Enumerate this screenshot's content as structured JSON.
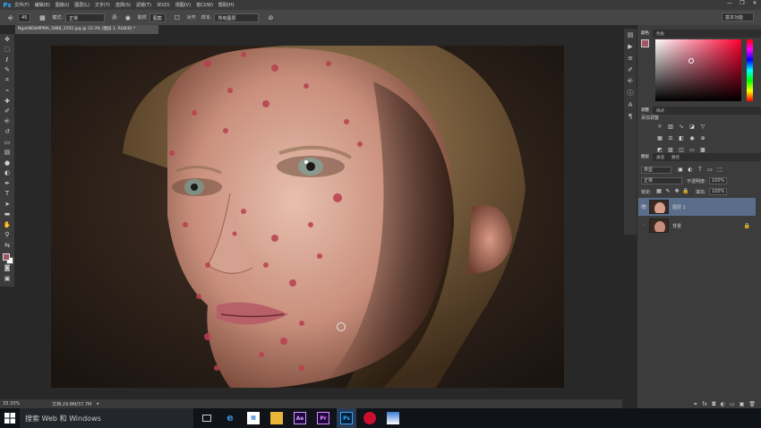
{
  "app": {
    "logo": "Ps"
  },
  "menu": [
    "文件(F)",
    "编辑(E)",
    "图像(I)",
    "图层(L)",
    "文字(Y)",
    "选择(S)",
    "滤镜(T)",
    "3D(D)",
    "视图(V)",
    "窗口(W)",
    "帮助(H)"
  ],
  "window_controls": [
    "—",
    "❐",
    "✕"
  ],
  "options": {
    "brush_size": "45",
    "mode_label": "模式:",
    "mode_value": "正常",
    "source_label": "源:",
    "source_sampled": "取样",
    "source_pattern": "图案",
    "aligned_label": "对齐",
    "sample_label": "样本:",
    "sample_value": "所有图层",
    "workspace": "基本功能"
  },
  "document": {
    "tab_title": "NgahNDkMPMA_5888_2592.jpg @ 33.3% (图层 1, RGB/8) *",
    "zoom": "33.33%",
    "doc_size": "文档:29.8M/37.7M"
  },
  "color_panel": {
    "tabs": [
      "颜色",
      "色板"
    ],
    "fg": "#a05563",
    "bg": "#ffffff"
  },
  "adjustments_panel": {
    "tabs": [
      "调整",
      "样式"
    ],
    "title": "添加调整"
  },
  "layers_panel": {
    "tabs": [
      "图层",
      "通道",
      "路径"
    ],
    "filter": "类型",
    "blend_mode": "正常",
    "opacity_label": "不透明度:",
    "opacity_value": "100%",
    "lock_label": "锁定:",
    "fill_label": "填充:",
    "fill_value": "100%",
    "layers": [
      {
        "name": "图层 1",
        "selected": true
      },
      {
        "name": "背景",
        "selected": false
      }
    ]
  },
  "taskbar": {
    "search_placeholder": "搜索 Web 和 Windows",
    "apps": [
      "task-view",
      "edge",
      "store",
      "explorer",
      "after-effects",
      "premiere",
      "photoshop",
      "media-player",
      "photos"
    ]
  },
  "colors": {
    "accent": "#31a8ff",
    "selected_layer": "#5a6d8a"
  }
}
